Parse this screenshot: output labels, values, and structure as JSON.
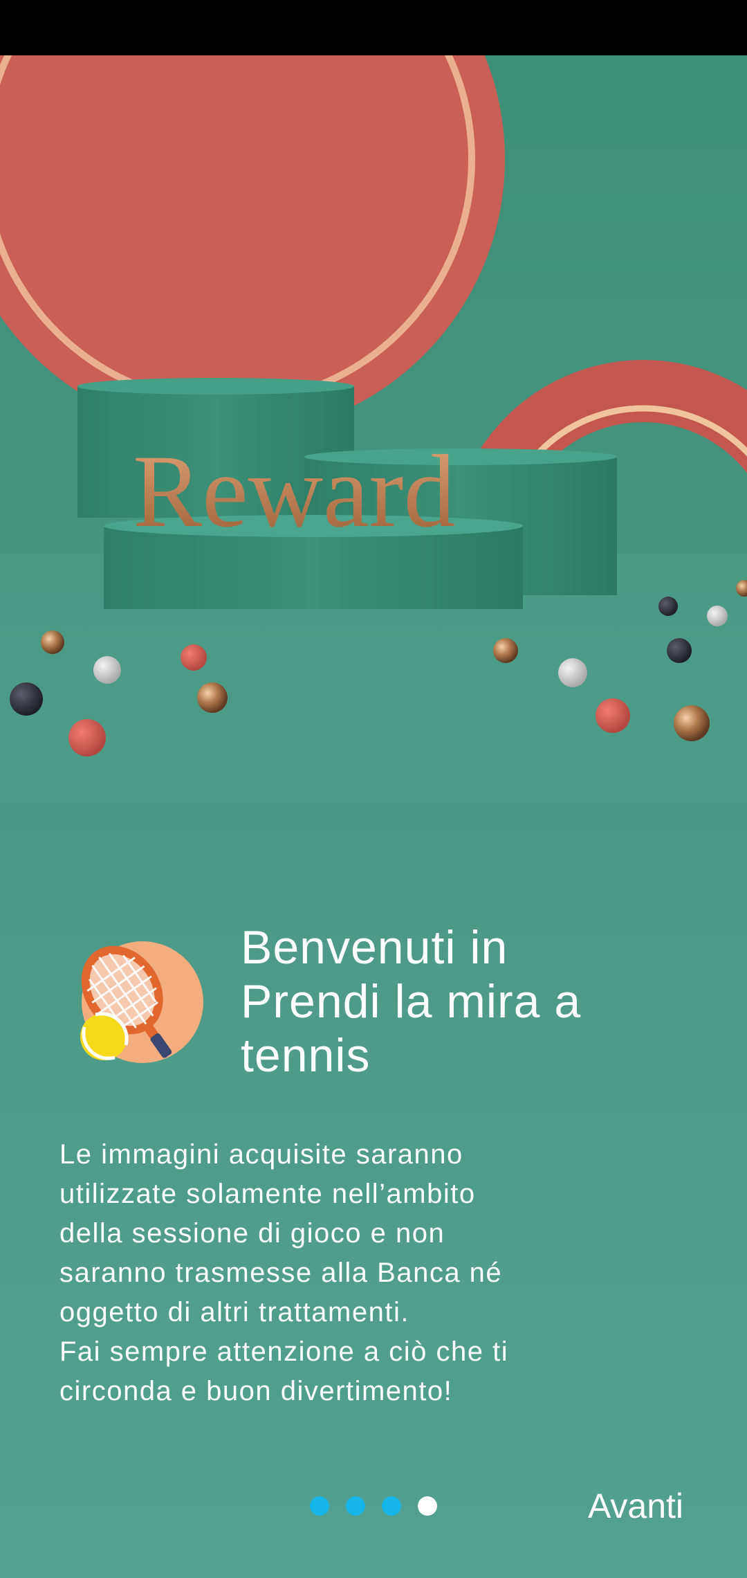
{
  "hero": {
    "banner_text": "Reward",
    "icon": "reward-scene-illustration"
  },
  "welcome": {
    "icon": "tennis-racket-icon",
    "title": "Benvenuti in\nPrendi la mira a\ntennis"
  },
  "description": {
    "text": "Le immagini acquisite saranno\nutilizzate solamente nell’ambito\ndella sessione di gioco e non\nsaranno trasmesse alla Banca né\noggetto di altri trattamenti.\nFai sempre attenzione a ciò che ti\ncirconda e buon divertimento!"
  },
  "pager": {
    "total": 4,
    "current": 4
  },
  "footer": {
    "next_label": "Avanti"
  },
  "colors": {
    "background": "#4f9d8a",
    "coral": "#c85e55",
    "dot_inactive": "#17b6ea",
    "dot_active": "#ffffff"
  }
}
